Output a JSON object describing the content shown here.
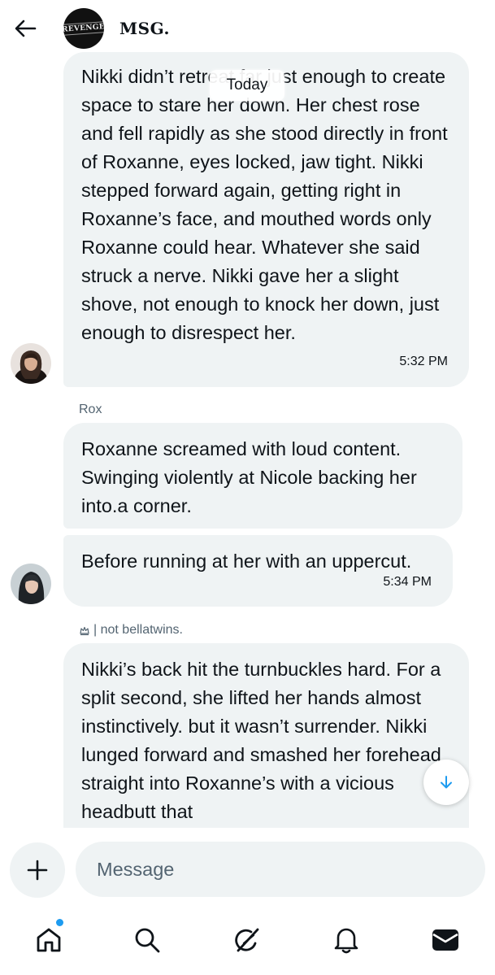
{
  "header": {
    "title": "MSG.",
    "group_logo_text": "REVENGE"
  },
  "conversation": {
    "date_divider": "Today",
    "messages": [
      {
        "text": "Nikki didn’t retreat far just enough to create space to stare her down. Her chest rose and fell rapidly as she stood directly in front of Roxanne, eyes locked, jaw tight. Nikki stepped forward again, getting right in Roxanne’s face, and mouthed words only Roxanne could hear. Whatever she said struck a nerve. Nikki gave her a slight shove, not enough to knock her down, just enough to disrespect her.",
        "time": "5:32 PM"
      },
      {
        "sender": "Rox",
        "text": "Roxanne screamed with loud content. Swinging violently at Nicole backing her into.a corner."
      },
      {
        "text": "Before running at her with an uppercut.",
        "time": "5:34 PM"
      },
      {
        "sender": "| not bellatwins.",
        "text": "Nikki’s back hit the turnbuckles hard. For a split second, she lifted her hands almost instinctively. but it wasn’t surrender. Nikki lunged forward and smashed her forehead straight into Roxanne’s with a vicious headbutt that"
      }
    ]
  },
  "composer": {
    "placeholder": "Message"
  },
  "nav": {
    "items": [
      "home-icon",
      "search-icon",
      "grok-icon",
      "notifications-icon",
      "messages-icon"
    ],
    "accent": "#1d9bf0"
  }
}
